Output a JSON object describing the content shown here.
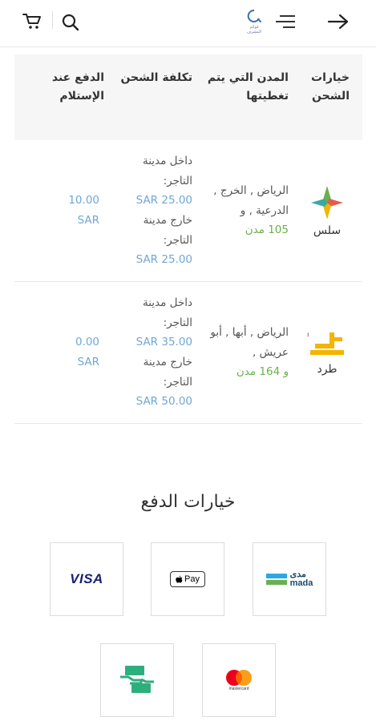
{
  "header": {
    "cart_icon": "cart-icon",
    "search_icon": "search-icon",
    "logo_caption": "قوائم المشرف",
    "menu_icon": "hamburger-menu-icon",
    "back_icon": "arrow-right-icon"
  },
  "shipping_table": {
    "headers": {
      "options": "خيارات الشحن",
      "cities": "المدن التي يتم تغطيتها",
      "cost": "تكلفة الشحن",
      "cod": "الدفع عند الإستلام"
    },
    "rows": [
      {
        "carrier": "سلس",
        "cities_main": "الرياض , الخرج , الدرعية , و",
        "cities_count": "105 مدن",
        "inside_label": "داخل مدينة التاجر:",
        "inside_price": "SAR 25.00",
        "outside_label": "خارج مدينة التاجر:",
        "outside_price": "SAR 25.00",
        "cod": "10.00 SAR"
      },
      {
        "carrier": "طرد",
        "cities_main": "الرياض , أبها , أبو عريش ,",
        "cities_count": "و 164 مدن",
        "inside_label": "داخل مدينة التاجر:",
        "inside_price": "SAR 35.00",
        "outside_label": "خارج مدينة التاجر:",
        "outside_price": "SAR 50.00",
        "cod": "0.00 SAR"
      }
    ]
  },
  "payment": {
    "title": "خيارات الدفع",
    "methods": {
      "visa": "VISA",
      "apple_pay": "Pay",
      "mada_ar": "مدى",
      "mada_en": "mada",
      "mastercard": "mastercard"
    }
  },
  "colors": {
    "accent_blue": "#6fa7d6",
    "accent_green": "#6ab04c",
    "header_bg": "#f6f6f6"
  }
}
